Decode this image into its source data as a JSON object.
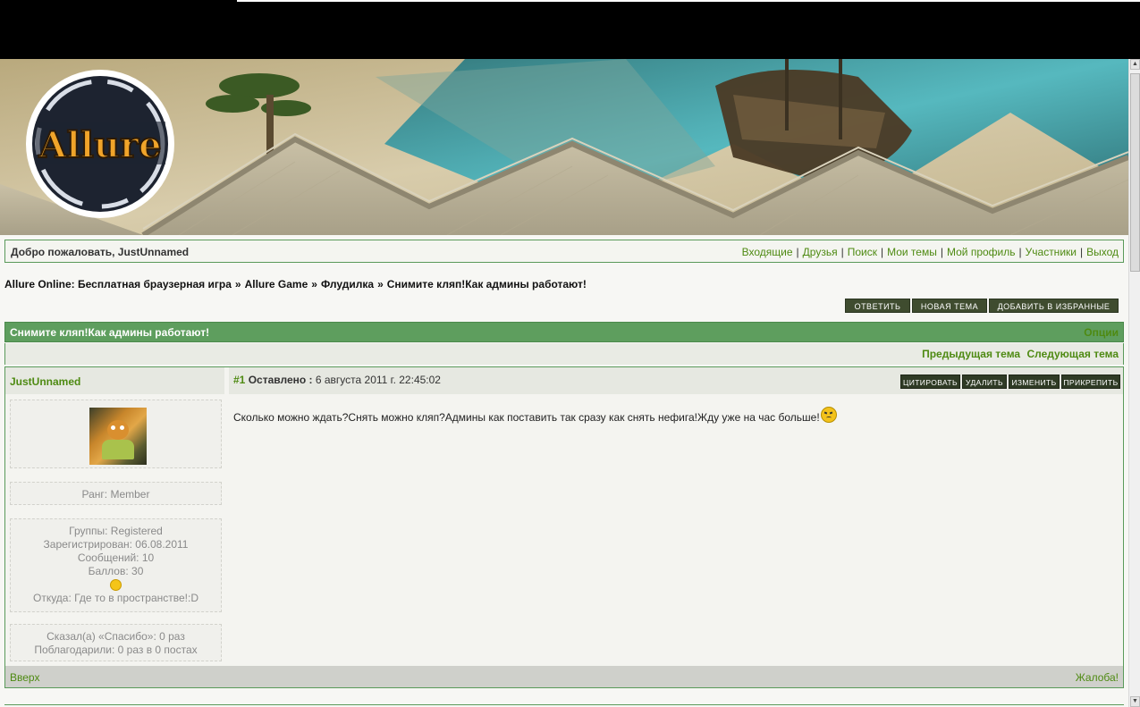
{
  "site": {
    "logo_text": "Allure"
  },
  "welcome": {
    "text": "Добро пожаловать, JustUnnamed"
  },
  "usernav": {
    "items": [
      "Входящие",
      "Друзья",
      "Поиск",
      "Мои темы",
      "Мой профиль",
      "Участники",
      "Выход"
    ]
  },
  "breadcrumb": {
    "items": [
      "Allure Online: Бесплатная браузерная игра",
      "Allure Game",
      "Флудилка",
      "Снимите кляп!Как админы работают!"
    ],
    "separator": "»"
  },
  "actions": {
    "reply": "ОТВЕТИТЬ",
    "new_topic": "НОВАЯ ТЕМА",
    "favorite": "ДОБАВИТЬ В ИЗБРАННЫЕ"
  },
  "topic": {
    "title": "Снимите кляп!Как админы работают!",
    "options": "Опции",
    "prev": "Предыдущая тема",
    "next": "Следующая тема"
  },
  "post": {
    "author": "JustUnnamed",
    "number": "#1",
    "posted_label": "Оставлено :",
    "date": "6 августа 2011 г. 22:45:02",
    "buttons": {
      "quote": "ЦИТИРОВАТЬ",
      "delete": "УДАЛИТЬ",
      "edit": "ИЗМЕНИТЬ",
      "pin": "ПРИКРЕПИТЬ"
    },
    "body": "Сколько можно ждать?Снять можно кляп?Админы как поставить так сразу как снять нефига!Жду уже на час больше!",
    "footer": {
      "up": "Вверх",
      "report": "Жалоба!"
    }
  },
  "profile": {
    "rank": "Ранг: Member",
    "groups": "Группы: Registered",
    "registered": "Зарегистрирован: 06.08.2011",
    "messages": "Сообщений: 10",
    "points": "Баллов: 30",
    "location": "Откуда: Где то в пространстве!:D",
    "said_thanks": "Сказал(а) «Спасибо»: 0 раз",
    "thanked": "Поблагодарили: 0 раз в 0 постах"
  },
  "colors": {
    "accent_green": "#4e8a12",
    "header_green": "#5e9e5e",
    "button_dark": "#3f4c2f"
  }
}
